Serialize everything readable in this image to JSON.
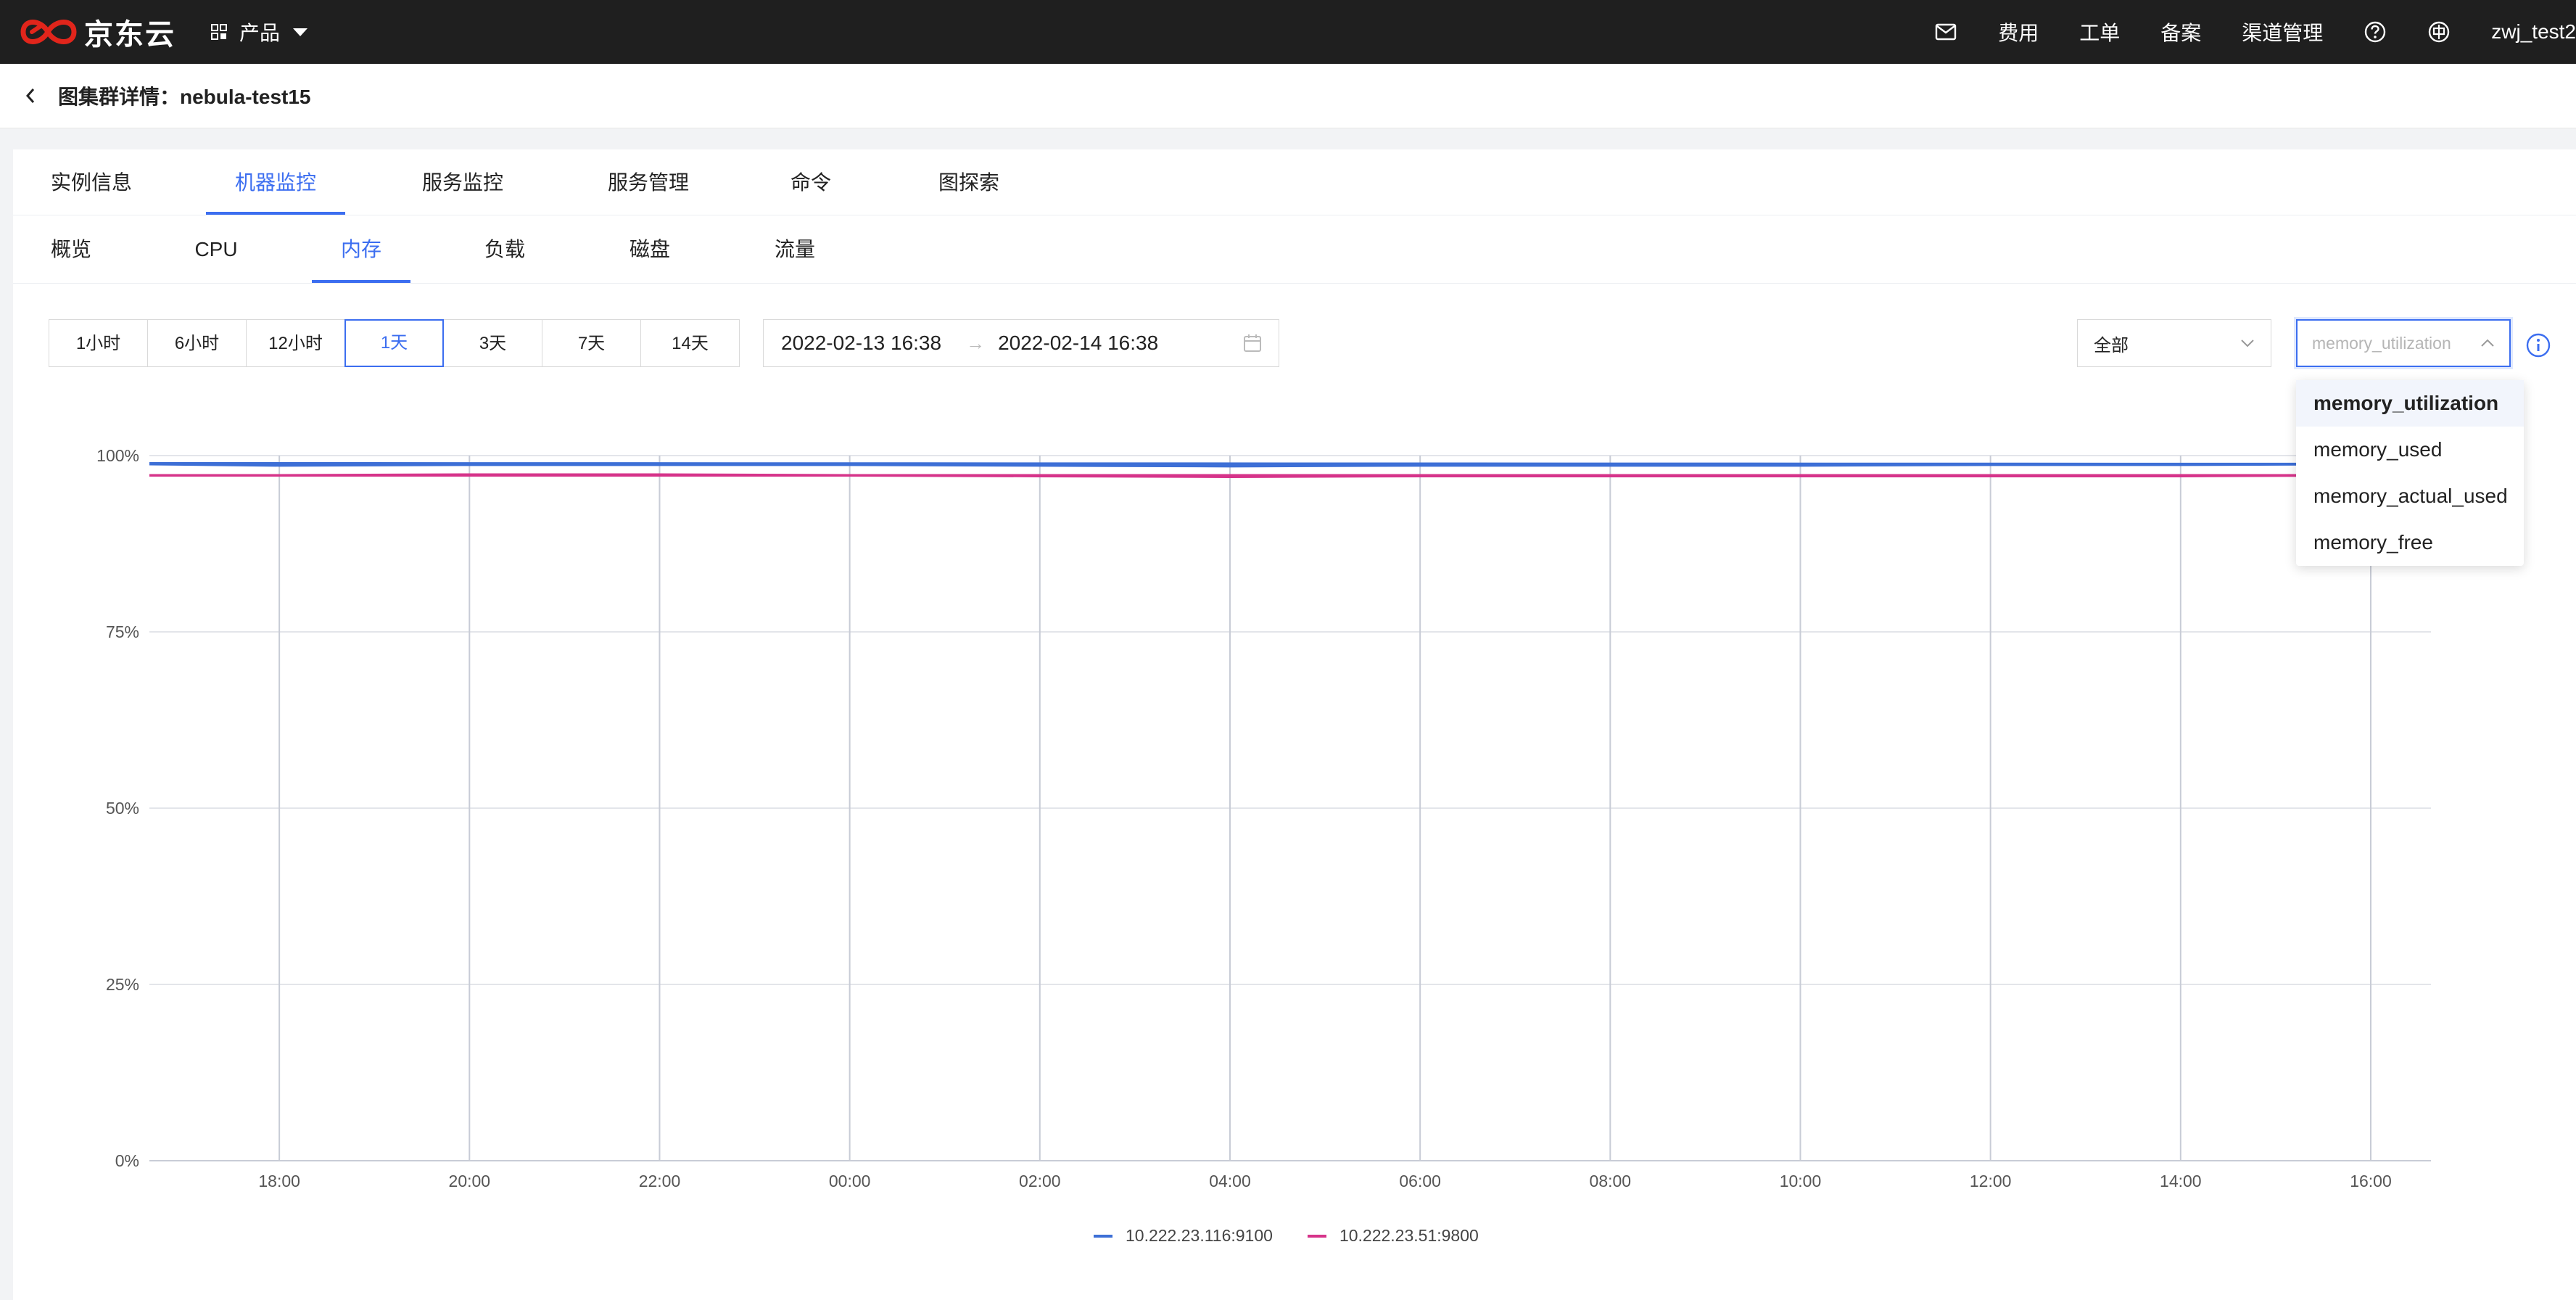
{
  "topbar": {
    "brand": "京东云",
    "product_label": "产品",
    "nav": [
      "费用",
      "工单",
      "备案",
      "渠道管理"
    ],
    "user": "zwj_test2",
    "icons": [
      "mail-icon",
      "help-icon",
      "globe-icon"
    ]
  },
  "header": {
    "title": "图集群详情：nebula-test15"
  },
  "tabs_primary": [
    {
      "label": "实例信息",
      "active": false
    },
    {
      "label": "机器监控",
      "active": true
    },
    {
      "label": "服务监控",
      "active": false
    },
    {
      "label": "服务管理",
      "active": false
    },
    {
      "label": "命令",
      "active": false
    },
    {
      "label": "图探索",
      "active": false
    }
  ],
  "tabs_secondary": [
    {
      "label": "概览",
      "active": false
    },
    {
      "label": "CPU",
      "active": false
    },
    {
      "label": "内存",
      "active": true
    },
    {
      "label": "负载",
      "active": false
    },
    {
      "label": "磁盘",
      "active": false
    },
    {
      "label": "流量",
      "active": false
    }
  ],
  "time_ranges": [
    {
      "label": "1小时",
      "active": false
    },
    {
      "label": "6小时",
      "active": false
    },
    {
      "label": "12小时",
      "active": false
    },
    {
      "label": "1天",
      "active": true
    },
    {
      "label": "3天",
      "active": false
    },
    {
      "label": "7天",
      "active": false
    },
    {
      "label": "14天",
      "active": false
    }
  ],
  "date_range": {
    "start": "2022-02-13 16:38",
    "end": "2022-02-14 16:38",
    "separator": "→"
  },
  "scope_select": {
    "value": "全部"
  },
  "metric_select": {
    "value": "memory_utilization"
  },
  "metric_options": [
    {
      "label": "memory_utilization",
      "selected": true
    },
    {
      "label": "memory_used",
      "selected": false
    },
    {
      "label": "memory_actual_used",
      "selected": false
    },
    {
      "label": "memory_free",
      "selected": false
    }
  ],
  "colors": {
    "accent": "#3c6ef0",
    "series1": "#3d6fd6",
    "series2": "#d6338a"
  },
  "chart_data": {
    "type": "line",
    "x": [
      "16:38",
      "18:00",
      "20:00",
      "22:00",
      "00:00",
      "02:00",
      "04:00",
      "06:00",
      "08:00",
      "10:00",
      "12:00",
      "14:00",
      "16:00",
      "16:38"
    ],
    "x_ticks": [
      "18:00",
      "20:00",
      "22:00",
      "00:00",
      "02:00",
      "04:00",
      "06:00",
      "08:00",
      "10:00",
      "12:00",
      "14:00",
      "16:00"
    ],
    "y_ticks": [
      "0%",
      "25%",
      "50%",
      "75%",
      "100%"
    ],
    "ylim": [
      0,
      100
    ],
    "grid": true,
    "legend_position": "bottom-center",
    "series": [
      {
        "name": "10.222.23.116:9100",
        "values": [
          98.8,
          98.6,
          98.7,
          98.7,
          98.7,
          98.6,
          98.5,
          98.6,
          98.6,
          98.6,
          98.7,
          98.7,
          98.8,
          98.9
        ]
      },
      {
        "name": "10.222.23.51:9800",
        "values": [
          97.2,
          97.2,
          97.3,
          97.3,
          97.2,
          97.1,
          97.0,
          97.1,
          97.1,
          97.1,
          97.1,
          97.1,
          97.2,
          97.2
        ]
      }
    ]
  }
}
